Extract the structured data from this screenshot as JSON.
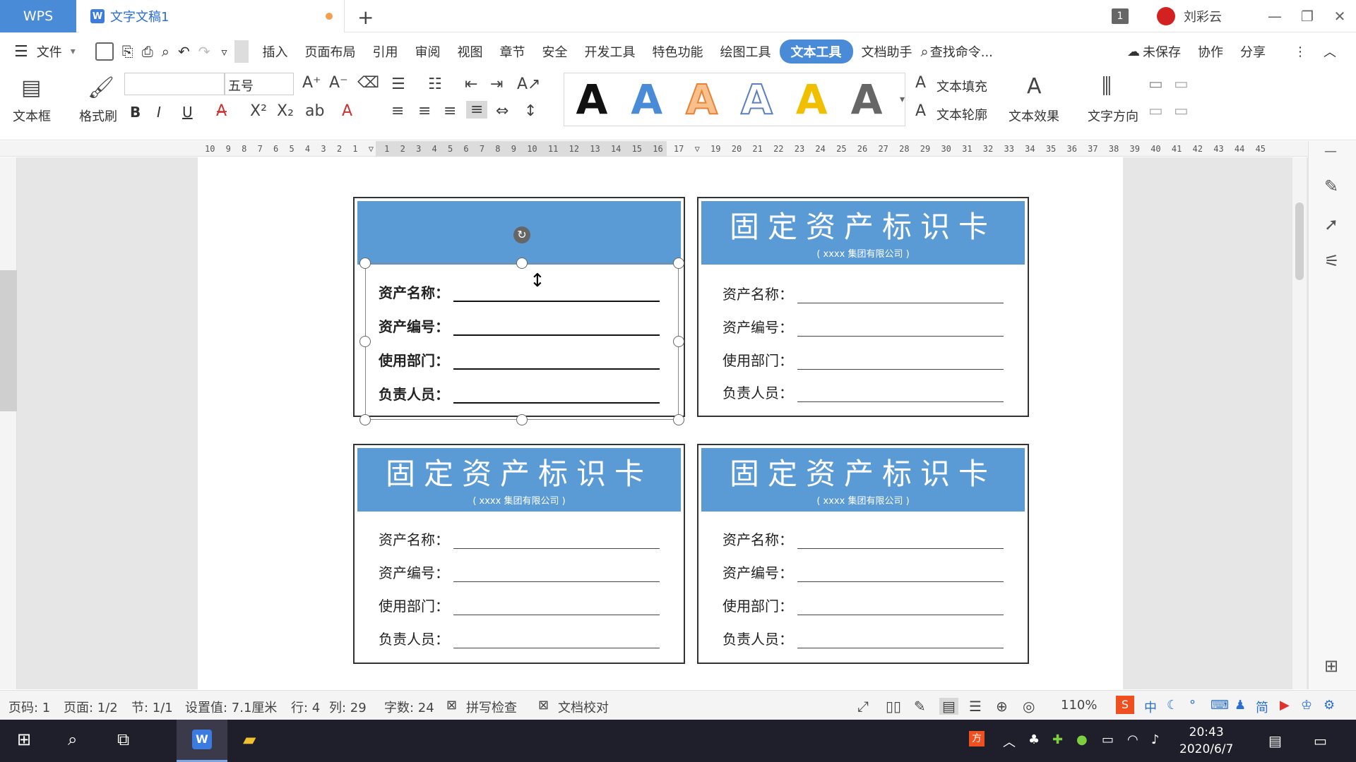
{
  "titlebar": {
    "app_tab": "WPS",
    "doc_tab": "文字文稿1",
    "doc_icon": "W",
    "new_tab": "+",
    "window_count": "1",
    "user_name": "刘彩云",
    "minimize": "—",
    "restore": "❐",
    "close": "✕"
  },
  "menu": {
    "file": "文件",
    "items": [
      "插入",
      "页面布局",
      "引用",
      "审阅",
      "视图",
      "章节",
      "安全",
      "开发工具",
      "特色功能",
      "绘图工具",
      "文本工具",
      "文档助手"
    ],
    "active": "文本工具",
    "search": "查找命令...",
    "unsaved": "未保存",
    "collab": "协作",
    "share": "分享"
  },
  "ribbon": {
    "textbox": "文本框",
    "format_painter": "格式刷",
    "font_size": "五号",
    "bold": "B",
    "italic": "I",
    "underline": "U",
    "text_fill": "文本填充",
    "text_outline": "文本轮廓",
    "text_effect": "文本效果",
    "text_direction": "文字方向",
    "wordart_letter": "A",
    "wordart_colors": [
      "#111111",
      "#4a8bd8",
      "#e8823a",
      "#5b7fbf",
      "#f0c000",
      "#666666"
    ]
  },
  "ruler": {
    "numbers": "10 9 8 7 6 5 4 3 2 1 ▽ 1 2 3 4 5 6 7 8 9 10 11 12 13 14 15 16 17 ▽ 19 20 21 22 23 24 25 26 27 28 29 30 31 32 33 34 35 36 37 38 39 40 41 42 43 44 45"
  },
  "cards": [
    {
      "title": "",
      "subtitle": "",
      "fields": [
        "资产名称：",
        "资产编号：",
        "使用部门：",
        "负责人员："
      ]
    },
    {
      "title": "固定资产标识卡",
      "subtitle": "( xxxx 集团有限公司 )",
      "fields": [
        "资产名称：",
        "资产编号：",
        "使用部门：",
        "负责人员："
      ]
    },
    {
      "title": "固定资产标识卡",
      "subtitle": "( xxxx 集团有限公司 )",
      "fields": [
        "资产名称：",
        "资产编号：",
        "使用部门：",
        "负责人员："
      ]
    },
    {
      "title": "固定资产标识卡",
      "subtitle": "( xxxx 集团有限公司 )",
      "fields": [
        "资产名称：",
        "资产编号：",
        "使用部门：",
        "负责人员："
      ]
    }
  ],
  "status": {
    "page_num": "页码: 1",
    "pages": "页面: 1/2",
    "section": "节: 1/1",
    "setting": "设置值: 7.1厘米",
    "row": "行: 4",
    "col": "列: 29",
    "words": "字数: 24",
    "spell": "拼写检查",
    "proof": "文档校对",
    "zoom": "110%"
  },
  "taskbar": {
    "time": "20:43",
    "date": "2020/6/7",
    "ime": "中",
    "simplified": "简"
  }
}
